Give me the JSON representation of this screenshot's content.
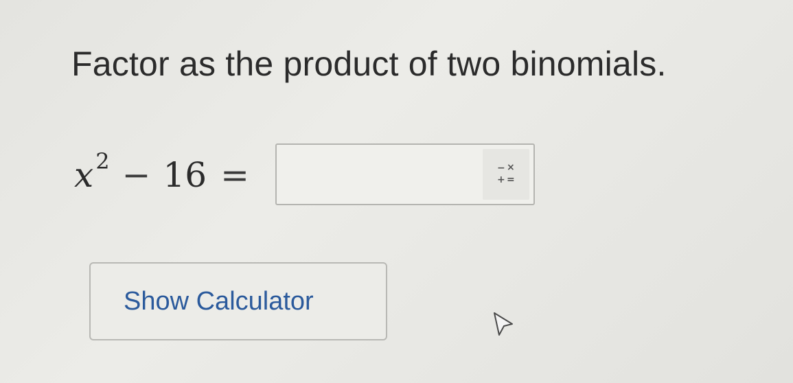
{
  "question": {
    "prompt": "Factor as the product of two binomials.",
    "expression": {
      "variable": "x",
      "exponent": "2",
      "operator": "−",
      "constant": "16",
      "equals": "="
    }
  },
  "answer": {
    "value": "",
    "placeholder": ""
  },
  "keypad": {
    "icon": "math-operators-icon",
    "symbols": {
      "minus": "−",
      "times": "×",
      "plus": "+",
      "equal": "="
    }
  },
  "calculator": {
    "button_label": "Show Calculator"
  },
  "colors": {
    "link_blue": "#2b5a9c",
    "text": "#2b2b2b",
    "border": "#b4b4b0"
  }
}
